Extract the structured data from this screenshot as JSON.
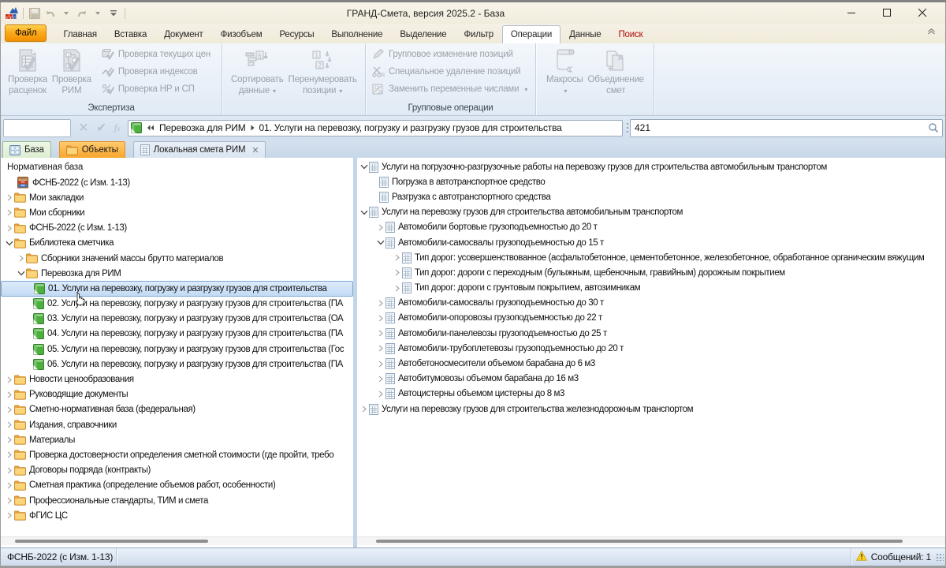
{
  "window": {
    "title": "ГРАНД-Смета, версия 2025.2 - База"
  },
  "qat": {
    "items": [
      "app-logo",
      "sep",
      "save",
      "undo",
      "dropdown",
      "redo",
      "dropdown",
      "customize",
      "sep"
    ]
  },
  "ribbon_tabs": [
    {
      "label": "Файл",
      "kind": "file"
    },
    {
      "label": "Главная"
    },
    {
      "label": "Вставка"
    },
    {
      "label": "Документ"
    },
    {
      "label": "Физобъем"
    },
    {
      "label": "Ресурсы"
    },
    {
      "label": "Выполнение"
    },
    {
      "label": "Выделение"
    },
    {
      "label": "Фильтр"
    },
    {
      "label": "Операции",
      "active": true
    },
    {
      "label": "Данные"
    },
    {
      "label": "Поиск",
      "red": true
    }
  ],
  "ribbon": {
    "groups": [
      {
        "label": "Экспертиза",
        "items": [
          {
            "type": "large",
            "icon": "doc-check",
            "lines": [
              "Проверка",
              "расценок"
            ]
          },
          {
            "type": "large",
            "icon": "rim-check",
            "lines": [
              "Проверка",
              "РИМ"
            ]
          },
          {
            "type": "smallcol",
            "buttons": [
              {
                "icon": "price-check",
                "label": "Проверка текущих цен"
              },
              {
                "icon": "index-check",
                "label": "Проверка индексов"
              },
              {
                "icon": "percent-check",
                "label": "Проверка НР и СП"
              }
            ]
          }
        ]
      },
      {
        "label": "",
        "items": [
          {
            "type": "large",
            "icon": "sort",
            "lines": [
              "Сортировать",
              "данные"
            ],
            "dd": true
          },
          {
            "type": "large",
            "icon": "renumber",
            "lines": [
              "Перенумеровать",
              "позиции"
            ],
            "dd": true
          }
        ]
      },
      {
        "label": "Групповые операции",
        "items": [
          {
            "type": "smallcol",
            "buttons": [
              {
                "icon": "pencil",
                "label": "Групповое изменение позиций"
              },
              {
                "icon": "scissors",
                "label": "Специальное удаление позиций"
              },
              {
                "icon": "replace",
                "label": "Заменить переменные числами",
                "dd": true
              }
            ]
          }
        ]
      },
      {
        "label": "",
        "items": [
          {
            "type": "large",
            "icon": "macros",
            "lines": [
              "Макросы"
            ],
            "dd": true
          },
          {
            "type": "large",
            "icon": "merge",
            "lines": [
              "Объединение",
              "смет"
            ]
          }
        ]
      }
    ]
  },
  "formula_bar": {
    "value": ""
  },
  "address": {
    "crumbs": [
      "Перевозка для РИМ",
      "01. Услуги на перевозку, погрузку и разгрузку грузов для строительства"
    ]
  },
  "search": {
    "value": "421"
  },
  "doc_tabs": [
    {
      "label": "База",
      "kind": "base",
      "icon": "cabinet"
    },
    {
      "label": "Объекты",
      "kind": "objects",
      "icon": "folder"
    },
    {
      "label": "Локальная смета РИМ",
      "kind": "estimate",
      "icon": "doc-grid",
      "closable": true
    }
  ],
  "left_panel": {
    "header": "Нормативная база",
    "items": [
      {
        "label": "ФСНБ-2022 (с Изм. 1-13)",
        "level": 0,
        "icon": "db"
      },
      {
        "label": "Мои закладки",
        "level": 0,
        "icon": "folder",
        "exp": "c"
      },
      {
        "label": "Мои сборники",
        "level": 0,
        "icon": "folder",
        "exp": "c"
      },
      {
        "label": "ФСНБ-2022 (с Изм. 1-13)",
        "level": 0,
        "icon": "folder",
        "exp": "c"
      },
      {
        "label": "Библиотека сметчика",
        "level": 0,
        "icon": "folder",
        "exp": "e"
      },
      {
        "label": "Сборники значений массы брутто материалов",
        "level": 1,
        "icon": "folder",
        "exp": "c"
      },
      {
        "label": "Перевозка для РИМ",
        "level": 1,
        "icon": "folder",
        "exp": "e"
      },
      {
        "label": "01. Услуги на перевозку, погрузку и разгрузку грузов для строительства",
        "level": 2,
        "icon": "sheet",
        "selected": true
      },
      {
        "label": "02. Услуги на перевозку, погрузку и разгрузку грузов для строительства (ПА",
        "level": 2,
        "icon": "sheet"
      },
      {
        "label": "03. Услуги на перевозку, погрузку и разгрузку грузов для строительства (ОА",
        "level": 2,
        "icon": "sheet"
      },
      {
        "label": "04. Услуги на перевозку, погрузку и разгрузку грузов для строительства (ПА",
        "level": 2,
        "icon": "sheet"
      },
      {
        "label": "05. Услуги на перевозку, погрузку и разгрузку грузов для строительства (Гос",
        "level": 2,
        "icon": "sheet"
      },
      {
        "label": "06. Услуги на перевозку, погрузку и разгрузку грузов для строительства (ПА",
        "level": 2,
        "icon": "sheet"
      },
      {
        "label": "Новости ценообразования",
        "level": 0,
        "icon": "folder",
        "exp": "c"
      },
      {
        "label": "Руководящие документы",
        "level": 0,
        "icon": "folder",
        "exp": "c"
      },
      {
        "label": "Сметно-нормативная база (федеральная)",
        "level": 0,
        "icon": "folder",
        "exp": "c"
      },
      {
        "label": "Издания, справочники",
        "level": 0,
        "icon": "folder",
        "exp": "c"
      },
      {
        "label": "Материалы",
        "level": 0,
        "icon": "folder",
        "exp": "c"
      },
      {
        "label": "Проверка достоверности определения сметной стоимости (где пройти, требо",
        "level": 0,
        "icon": "folder",
        "exp": "c"
      },
      {
        "label": "Договоры подряда (контракты)",
        "level": 0,
        "icon": "folder",
        "exp": "c"
      },
      {
        "label": "Сметная практика (определение объемов работ, особенности)",
        "level": 0,
        "icon": "folder",
        "exp": "c"
      },
      {
        "label": "Профессиональные стандарты, ТИМ и смета",
        "level": 0,
        "icon": "folder",
        "exp": "c"
      },
      {
        "label": "ФГИС ЦС",
        "level": 0,
        "icon": "folder",
        "exp": "c"
      }
    ]
  },
  "right_panel": {
    "items": [
      {
        "label": "Услуги на погрузочно-разгрузочные работы на перевозку грузов для строительства автомобильным транспортом",
        "level": 0,
        "icon": "doc-grid",
        "exp": "e"
      },
      {
        "label": "Погрузка в автотранспортное средство",
        "level": 1,
        "icon": "doc-grid"
      },
      {
        "label": "Разгрузка с автотранспортного средства",
        "level": 1,
        "icon": "doc-grid"
      },
      {
        "label": "Услуги на перевозку грузов для строительства автомобильным транспортом",
        "level": 0,
        "icon": "doc-grid",
        "exp": "e"
      },
      {
        "label": "Автомобили бортовые грузоподъемностью до 20 т",
        "level": 1,
        "icon": "doc-grid",
        "exp": "c"
      },
      {
        "label": "Автомобили-самосвалы грузоподъемностью до 15 т",
        "level": 1,
        "icon": "doc-grid",
        "exp": "e"
      },
      {
        "label": "Тип дорог: усовершенствованное (асфальтобетонное, цементобетонное, железобетонное, обработанное органическим вяжущим",
        "level": 2,
        "icon": "doc-grid",
        "exp": "c"
      },
      {
        "label": "Тип дорог: дороги с переходным (булыжным, щебеночным, гравийным) дорожным покрытием",
        "level": 2,
        "icon": "doc-grid",
        "exp": "c"
      },
      {
        "label": "Тип дорог: дороги с грунтовым покрытием, автозимникам",
        "level": 2,
        "icon": "doc-grid",
        "exp": "c"
      },
      {
        "label": "Автомобили-самосвалы грузоподъемностью до 30 т",
        "level": 1,
        "icon": "doc-grid",
        "exp": "c"
      },
      {
        "label": "Автомобили-опоровозы грузоподъемностью до 22 т",
        "level": 1,
        "icon": "doc-grid",
        "exp": "c"
      },
      {
        "label": "Автомобили-панелевозы грузоподъемностью до 25 т",
        "level": 1,
        "icon": "doc-grid",
        "exp": "c"
      },
      {
        "label": "Автомобили-трубоплетевозы грузоподъемностью до 20 т",
        "level": 1,
        "icon": "doc-grid",
        "exp": "c"
      },
      {
        "label": "Автобетоносмесители объемом барабана до 6 м3",
        "level": 1,
        "icon": "doc-grid",
        "exp": "c"
      },
      {
        "label": "Автобитумовозы объемом барабана до 16 м3",
        "level": 1,
        "icon": "doc-grid",
        "exp": "c"
      },
      {
        "label": "Автоцистерны объемом цистерны до 8 м3",
        "level": 1,
        "icon": "doc-grid",
        "exp": "c"
      },
      {
        "label": "Услуги на перевозку грузов для строительства железнодорожным транспортом",
        "level": 0,
        "icon": "doc-grid",
        "exp": "c"
      }
    ]
  },
  "status": {
    "left": "ФСНБ-2022 (с Изм. 1-13)",
    "messages": "Сообщений: 1"
  }
}
